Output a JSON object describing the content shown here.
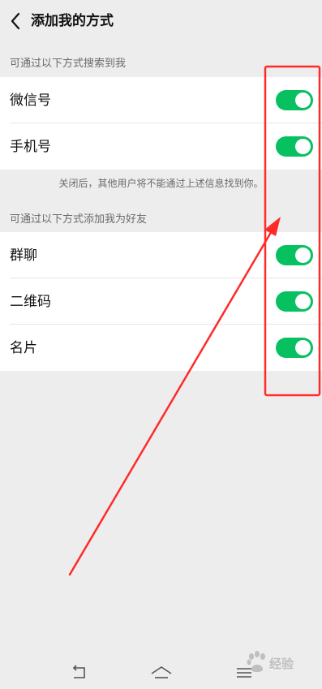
{
  "header": {
    "title": "添加我的方式",
    "back_icon": "chevron-left-icon"
  },
  "search_section": {
    "header": "可通过以下方式搜索到我",
    "items": [
      {
        "label": "微信号",
        "enabled": true
      },
      {
        "label": "手机号",
        "enabled": true
      }
    ],
    "hint": "关闭后，其他用户将不能通过上述信息找到你。"
  },
  "add_section": {
    "header": "可通过以下方式添加我为好友",
    "items": [
      {
        "label": "群聊",
        "enabled": true
      },
      {
        "label": "二维码",
        "enabled": true
      },
      {
        "label": "名片",
        "enabled": true
      }
    ]
  },
  "colors": {
    "toggle_on": "#07c160",
    "annotation_red": "#ff2a2a",
    "background": "#ededed"
  },
  "navbar": {
    "icons": [
      "back-nav-icon",
      "home-nav-icon",
      "menu-nav-icon"
    ]
  },
  "watermark": {
    "text": "经验"
  }
}
